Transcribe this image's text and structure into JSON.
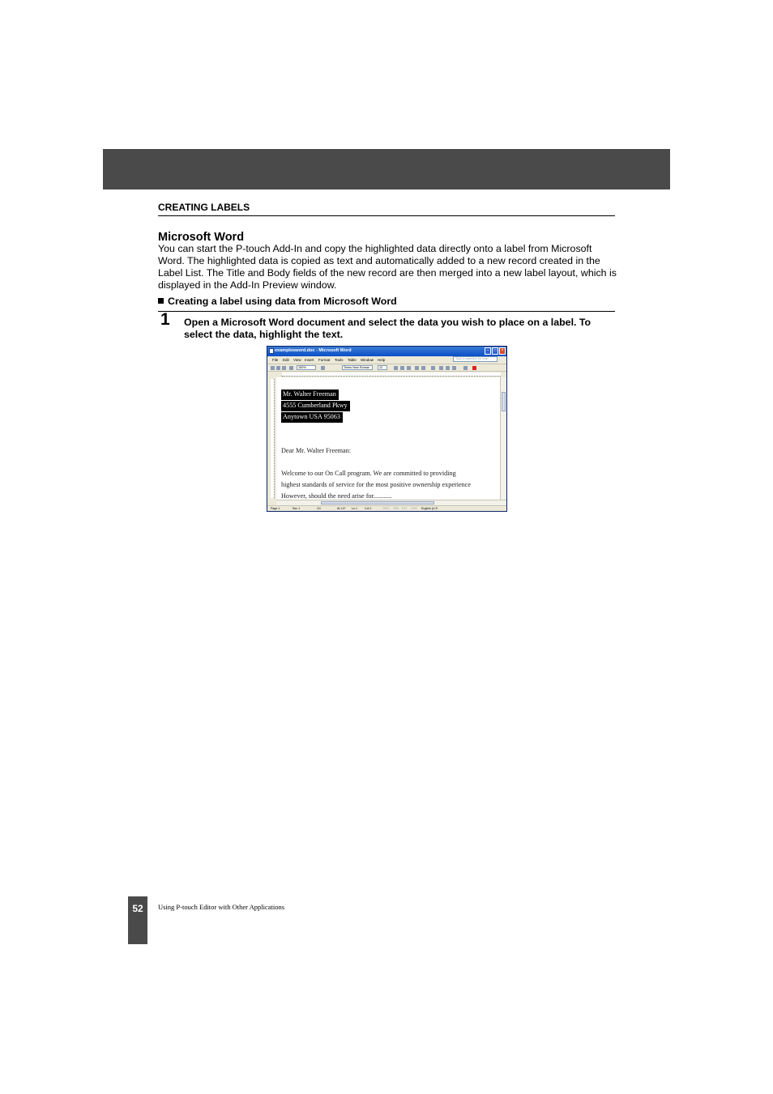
{
  "header": {
    "section_title": "CREATING LABELS"
  },
  "content": {
    "heading": "Microsoft Word",
    "intro": "You can start the P-touch Add-In and copy the highlighted data directly onto a label from Microsoft Word. The highlighted data is copied as text and automatically added to a new record created in the Label List. The Title and Body fields of the new record are then merged into a new label layout, which is displayed in the Add-In Preview window.",
    "subheading": "Creating a label using data from Microsoft Word",
    "step": {
      "number": "1",
      "text": "Open a Microsoft Word document and select the data you wish to place on a label. To select the data, highlight the text."
    }
  },
  "screenshot": {
    "title": "examplesword.doc - Microsoft Word",
    "menu": [
      "File",
      "Edit",
      "View",
      "Insert",
      "Format",
      "Tools",
      "Table",
      "Window",
      "Help"
    ],
    "help_placeholder": "Type a question for help",
    "zoom": "150%",
    "font_name": "Times New Roman",
    "font_size": "12",
    "highlighted_lines": [
      "Mr. Walter Freeman",
      "4555 Cumberland Pkwy",
      "Anytown    USA      95063"
    ],
    "body_lines": [
      "Dear Mr. Walter Freeman:",
      "Welcome  to  our  On  Call  program.    We  are  committed  to  providing",
      "highest standards of service for the most positive ownership experience",
      "However, should the need arise for..........."
    ],
    "status": {
      "page": "Page 1",
      "sec": "Sec 1",
      "pages": "1/1",
      "at": "At 1.5\"",
      "ln": "Ln 1",
      "col": "Col 1",
      "modes": [
        "REC",
        "TRK",
        "EXT",
        "OVR"
      ],
      "language": "English (U.S"
    },
    "colors": {
      "titlebar": "#0a4fc6",
      "highlight": "#000000"
    }
  },
  "footer": {
    "page_number": "52",
    "text": "Using P-touch Editor with Other Applications"
  }
}
